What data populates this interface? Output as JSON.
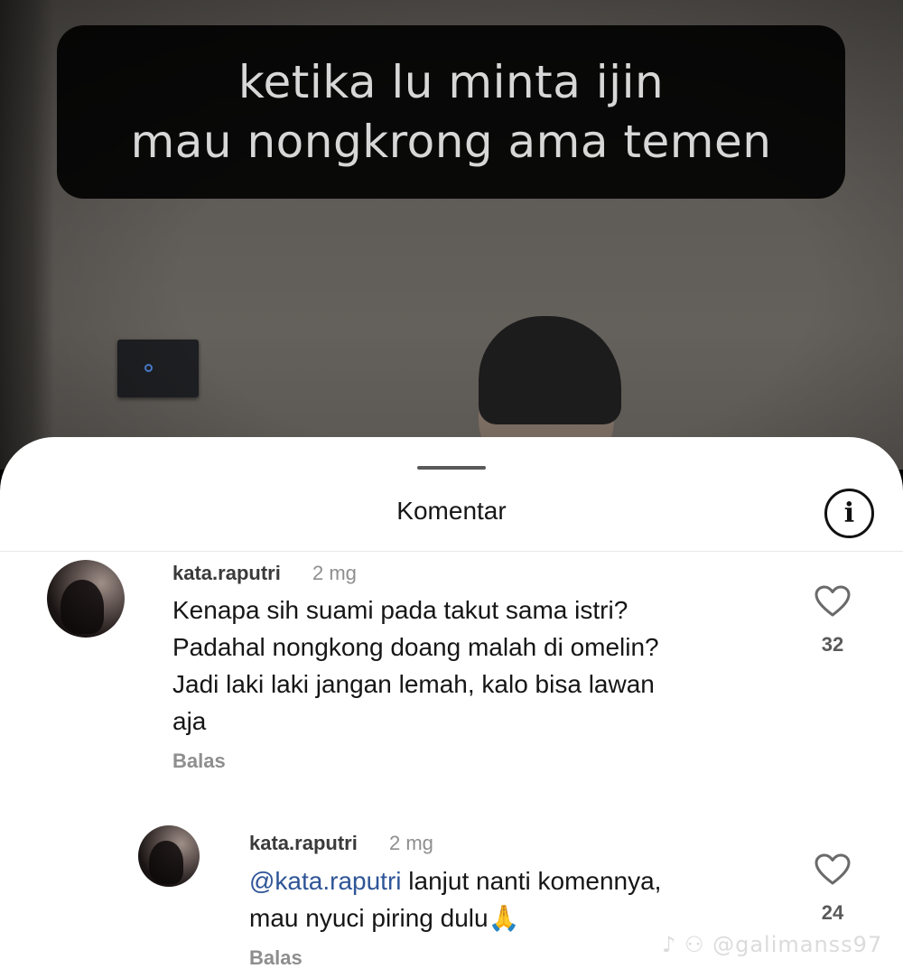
{
  "video": {
    "caption_line1": "ketika lu minta ijin",
    "caption_line2": "mau nongkrong ama temen"
  },
  "comments_panel": {
    "title": "Komentar",
    "info_icon_glyph": "i",
    "comments": [
      {
        "username": "kata.raputri",
        "time": "2 mg",
        "text": "Kenapa sih suami pada takut sama istri?\nPadahal nongkong doang malah di omelin?\nJadi laki laki jangan lemah, kalo bisa lawan\naja",
        "reply_label": "Balas",
        "likes": "32"
      },
      {
        "username": "kata.raputri",
        "time": "2 mg",
        "mention": "@kata.raputri",
        "text": " lanjut nanti komennya,\nmau nyuci piring dulu🙏",
        "reply_label": "Balas",
        "likes": "24"
      }
    ]
  },
  "watermark": "♪ ⚇ @galimanss97",
  "icons": {
    "like": "heart-outline-icon",
    "info": "info-circle-icon"
  },
  "colors": {
    "mention": "#2f5597",
    "muted_text": "#8e8e8e"
  }
}
